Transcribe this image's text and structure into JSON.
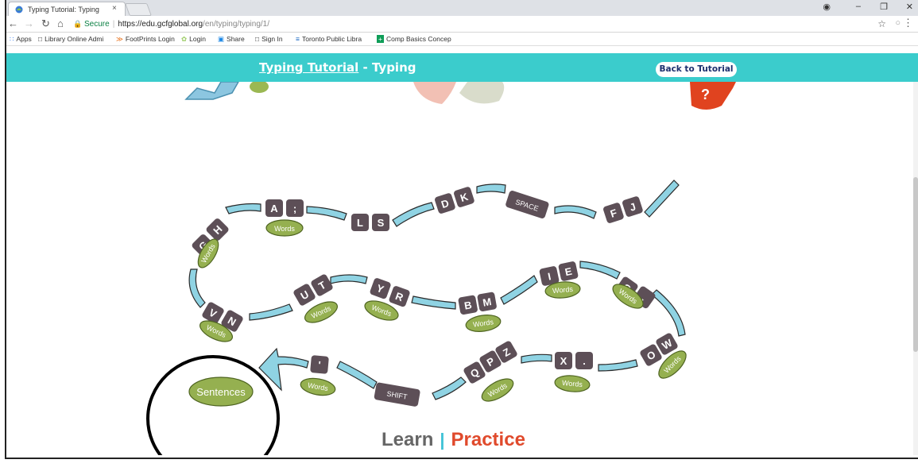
{
  "browser": {
    "tab_title": "Typing Tutorial: Typing",
    "tab_close": "×",
    "url_secure": "Secure",
    "url_host": "https://edu.gcfglobal.org",
    "url_path": "/en/typing/typing/1/",
    "bookmarks": [
      "Apps",
      "Library Online Admi",
      "FootPrints Login",
      "Login",
      "Share",
      "Sign In",
      "Toronto Public Libra",
      "Comp Basics Concep"
    ]
  },
  "header": {
    "title_link": "Typing Tutorial",
    "title_rest": " - Typing",
    "back_button": "Back to Tutorial"
  },
  "path": {
    "keys": [
      "A",
      ";",
      "L",
      "S",
      "D",
      "K",
      "SPACE",
      "F",
      "J",
      "G",
      "H",
      "V",
      "N",
      "U",
      "T",
      "Y",
      "R",
      "B",
      "M",
      "I",
      "E",
      "C",
      ",",
      "O",
      "W",
      "'",
      "SHIFT",
      "Q",
      "P",
      "Z",
      "X",
      "."
    ],
    "words_label": "Words",
    "sentences_label": "Sentences"
  },
  "footer": {
    "learn": "Learn",
    "divider": "|",
    "practice": "Practice"
  },
  "colors": {
    "header": "#3bcccc",
    "key": "#5d4f57",
    "road": "#8fd3e3",
    "words": "#95b050",
    "practice": "#e04a2c"
  }
}
